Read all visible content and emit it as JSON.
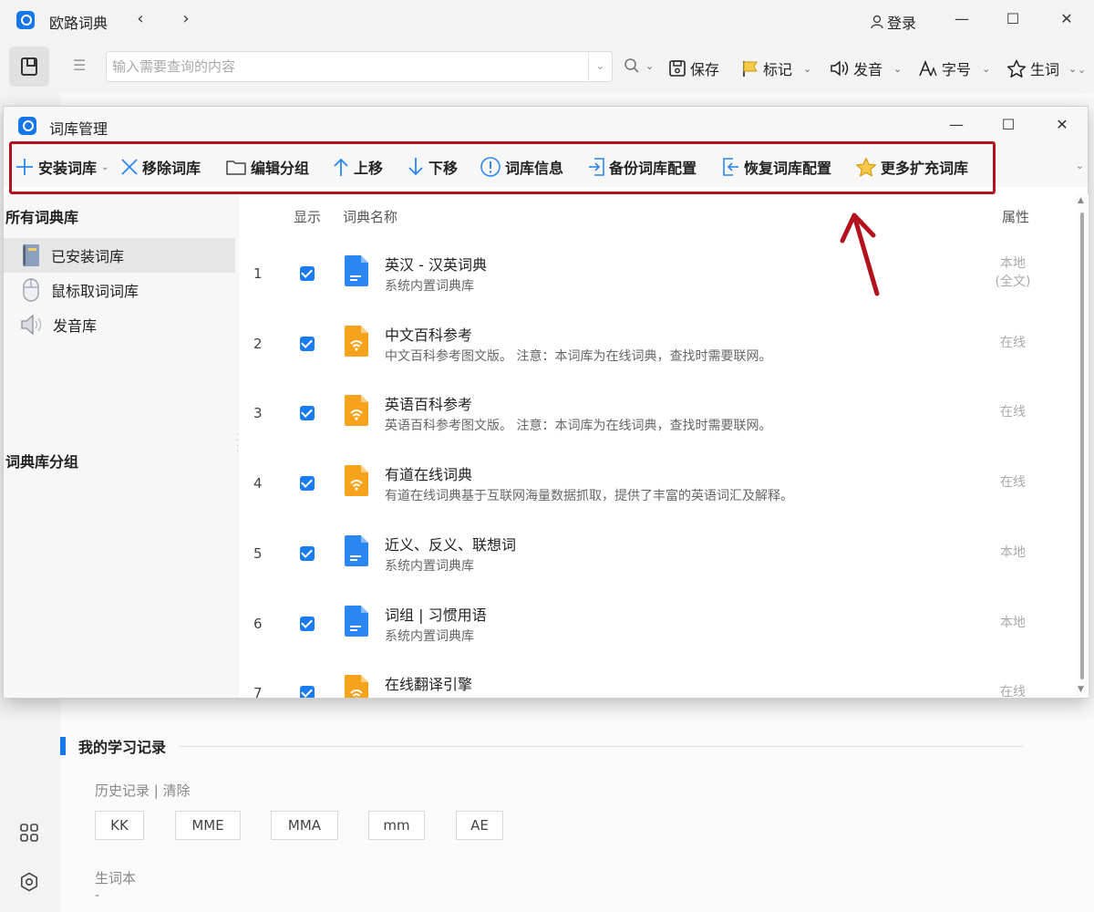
{
  "app": {
    "title": "欧路词典",
    "login_label": "登录"
  },
  "nav": {
    "back": "‹",
    "forward": "›"
  },
  "window_controls": {
    "minimize": "—",
    "maximize": "☐",
    "close": "✕"
  },
  "search": {
    "placeholder": "输入需要查询的内容",
    "value": ""
  },
  "toolbar": {
    "save": "保存",
    "mark": "标记",
    "pronounce": "发音",
    "font_size": "字号",
    "vocab": "生词"
  },
  "dialog": {
    "title": "词库管理",
    "toolbar": {
      "install": "安装词库",
      "remove": "移除词库",
      "edit_group": "编辑分组",
      "move_up": "上移",
      "move_down": "下移",
      "info": "词库信息",
      "backup": "备份词库配置",
      "restore": "恢复词库配置",
      "more": "更多扩充词库"
    },
    "sidebar": {
      "all_header": "所有词典库",
      "items": [
        {
          "label": "已安装词库",
          "icon": "book-icon"
        },
        {
          "label": "鼠标取词词库",
          "icon": "mouse-icon"
        },
        {
          "label": "发音库",
          "icon": "speaker-icon"
        }
      ],
      "group_header": "词典库分组"
    },
    "table": {
      "headers": {
        "show": "显示",
        "name": "词典名称",
        "attr": "属性"
      },
      "rows": [
        {
          "num": "1",
          "name": "英汉 - 汉英词典",
          "desc": "系统内置词典库",
          "attr": "本地\n(全文)",
          "type": "local"
        },
        {
          "num": "2",
          "name": "中文百科参考",
          "desc": "中文百科参考图文版。  注意：本词库为在线词典，查找时需要联网。",
          "attr": "在线",
          "type": "online"
        },
        {
          "num": "3",
          "name": "英语百科参考",
          "desc": "英语百科参考图文版。  注意：本词库为在线词典，查找时需要联网。",
          "attr": "在线",
          "type": "online"
        },
        {
          "num": "4",
          "name": "有道在线词典",
          "desc": "有道在线词典基于互联网海量数据抓取，提供了丰富的英语词汇及解释。",
          "attr": "在线",
          "type": "online"
        },
        {
          "num": "5",
          "name": "近义、反义、联想词",
          "desc": "系统内置词典库",
          "attr": "本地",
          "type": "local"
        },
        {
          "num": "6",
          "name": "词组 | 习惯用语",
          "desc": "系统内置词典库",
          "attr": "本地",
          "type": "local"
        },
        {
          "num": "7",
          "name": "在线翻译引擎",
          "desc": "",
          "attr": "在线",
          "type": "online"
        }
      ]
    }
  },
  "study": {
    "section_title": "我的学习记录",
    "history_label": "历史记录 | 清除",
    "history_chips": [
      "KK",
      "MME",
      "MMA",
      "mm",
      "AE"
    ],
    "vocab_label": "生词本",
    "vocab_empty": "-"
  },
  "colors": {
    "accent": "#1677e8",
    "highlight_border": "#b3121c",
    "online_icon": "#f7a21b",
    "local_icon": "#2a86f0"
  }
}
